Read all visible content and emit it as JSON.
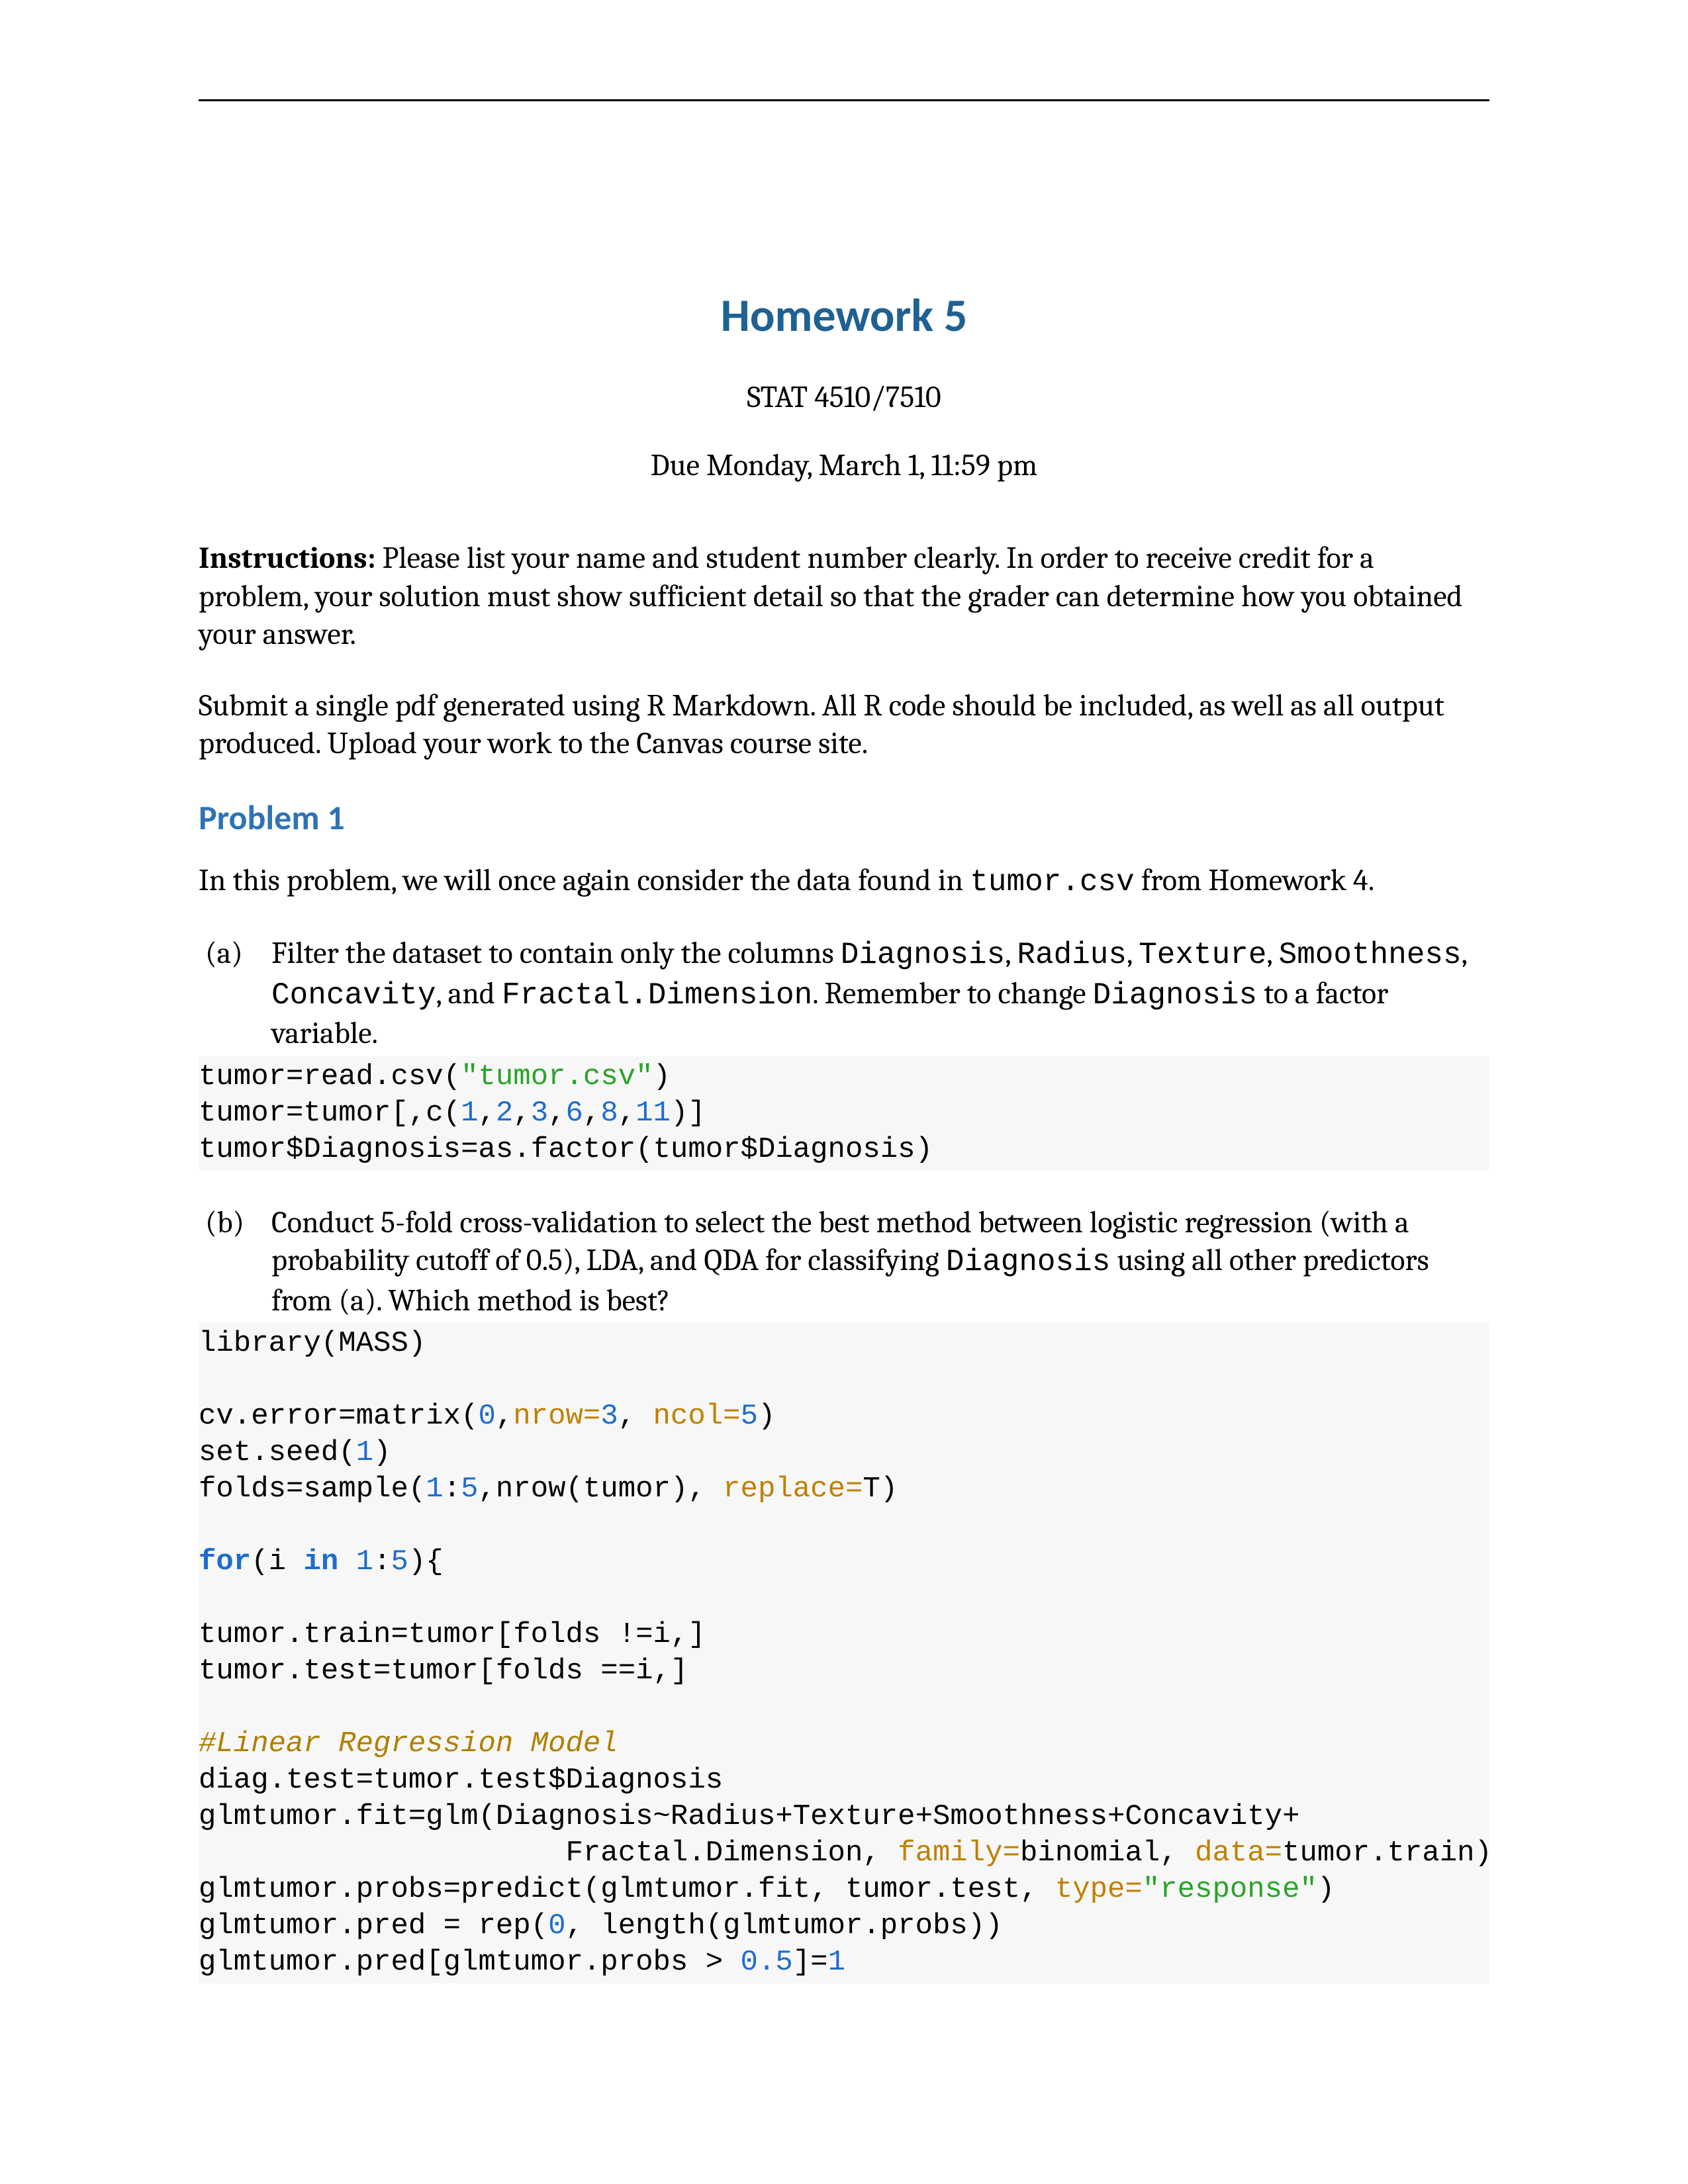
{
  "header": {
    "title": "Homework 5",
    "course": "STAT 4510/7510",
    "due": "Due Monday, March 1, 11:59 pm"
  },
  "instructions": {
    "label": "Instructions:",
    "p1_rest": " Please list your name and student number clearly. In order to receive credit for a problem, your solution must show sufficient detail so that the grader can determine how you obtained your answer.",
    "p2": "Submit a single pdf generated using R Markdown. All R code should be included, as well as all output produced. Upload your work to the Canvas course site."
  },
  "problem1": {
    "heading": "Problem 1",
    "intro_pre": "In this problem, we will once again consider the data found in ",
    "intro_file": "tumor.csv",
    "intro_post": " from Homework 4.",
    "a": {
      "label": "(a)",
      "t1": "Filter the dataset to contain only the columns ",
      "c1": "Diagnosis",
      "t2": ", ",
      "c2": "Radius",
      "t3": ", ",
      "c3": "Texture",
      "t4": ", ",
      "c4": "Smoothness",
      "t5": ", ",
      "c5": "Concavity",
      "t6": ", and ",
      "c6": "Fractal.Dimension",
      "t7": ". Remember to change ",
      "c7": "Diagnosis",
      "t8": " to a factor variable."
    },
    "codeA": {
      "l1a": "tumor=read.csv(",
      "l1b": "\"tumor.csv\"",
      "l1c": ")",
      "l2a": "tumor=tumor[,c(",
      "l2n1": "1",
      "l2n2": "2",
      "l2n3": "3",
      "l2n4": "6",
      "l2n5": "8",
      "l2n6": "11",
      "l2b": ")]",
      "l3": "tumor$Diagnosis=as.factor(tumor$Diagnosis)"
    },
    "b": {
      "label": "(b)",
      "t1": "Conduct 5-fold cross-validation to select the best method between logistic regression (with a probability cutoff of 0.5), LDA, and QDA for classifying ",
      "c1": "Diagnosis",
      "t2": " using all other predictors from (a). Which method is best?"
    },
    "codeB": {
      "l1": "library(MASS)",
      "l3a": "cv.error=matrix(",
      "l3n0": "0",
      "l3b": ",",
      "l3kw1": "nrow=",
      "l3n1": "3",
      "l3c": ", ",
      "l3kw2": "ncol=",
      "l3n2": "5",
      "l3d": ")",
      "l4a": "set.seed(",
      "l4n": "1",
      "l4b": ")",
      "l5a": "folds=sample(",
      "l5n1": "1",
      "l5n2": "5",
      "l5b": ",nrow(tumor), ",
      "l5kw": "replace=",
      "l5c": "T)",
      "l7a": "for",
      "l7b": "(i ",
      "l7in": "in",
      "l7c": " ",
      "l7n1": "1",
      "l7n2": "5",
      "l7d": "){",
      "l9": "tumor.train=tumor[folds !=i,]",
      "l10": "tumor.test=tumor[folds ==i,]",
      "l12": "#Linear Regression Model",
      "l13": "diag.test=tumor.test$Diagnosis",
      "l14a": "glmtumor.fit=glm(Diagnosis~Radius+Texture+Smoothness+Concavity+",
      "l15a": "                     Fractal.Dimension, ",
      "l15kw1": "family=",
      "l15b": "binomial, ",
      "l15kw2": "data=",
      "l15c": "tumor.train)",
      "l16a": "glmtumor.probs=predict(glmtumor.fit, tumor.test, ",
      "l16kw": "type=",
      "l16str": "\"response\"",
      "l16b": ")",
      "l17a": "glmtumor.pred = rep(",
      "l17n": "0",
      "l17b": ", length(glmtumor.probs))",
      "l18a": "glmtumor.pred[glmtumor.probs > ",
      "l18n": "0.5",
      "l18b": "]=",
      "l18n2": "1"
    }
  }
}
